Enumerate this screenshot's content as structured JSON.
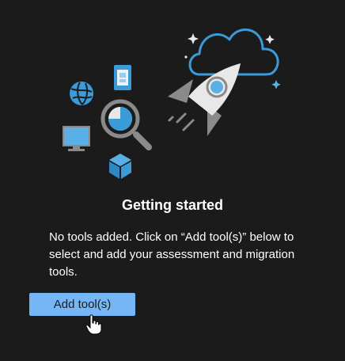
{
  "empty_state": {
    "title": "Getting started",
    "description": "No tools added. Click on “Add tool(s)” below to select and add your assessment and migration tools.",
    "add_button_label": "Add tool(s)"
  },
  "colors": {
    "background": "#1b1b1b",
    "accent": "#75b6f6",
    "cloud_outline": "#3a9bd8",
    "rocket_body": "#e8e8e8",
    "rocket_fins": "#8a8a8a"
  },
  "icons": [
    "globe-icon",
    "mobile-device-icon",
    "search-chart-icon",
    "monitor-icon",
    "cube-icon",
    "rocket-icon",
    "cloud-icon",
    "sparkle-icon",
    "hand-pointer-icon"
  ]
}
